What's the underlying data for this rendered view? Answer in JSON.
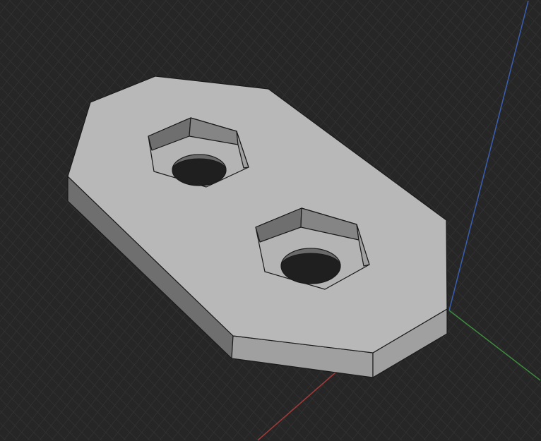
{
  "viewport": {
    "background": "#262626",
    "grid_color": "#333333",
    "face_top": "#b8b8b8",
    "face_side_dark": "#6f6f6f",
    "face_side_light": "#a0a0a0",
    "edge_color": "#1a1a1a",
    "axis_x_color": "#a33a3a",
    "axis_y_color": "#3e8a3e",
    "axis_z_color": "#3a5fb0"
  }
}
